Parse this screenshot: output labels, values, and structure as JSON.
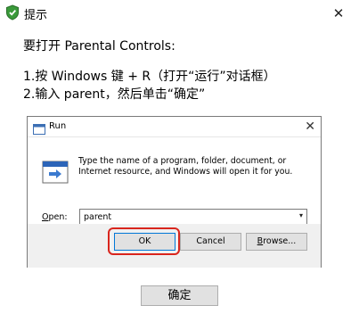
{
  "window": {
    "title": "提示",
    "close_glyph": "✕"
  },
  "instructions": {
    "heading": "要打开 Parental Controls:",
    "step1": "1.按 Windows 键 + R（打开“运行”对话框）",
    "step2": "2.输入 parent，然后单击“确定”"
  },
  "run_dialog": {
    "title": "Run",
    "close_glyph": "✕",
    "description": "Type the name of a program, folder, document, or Internet resource, and Windows will open it for you.",
    "open_label_accel": "O",
    "open_label_rest": "pen:",
    "open_value": "parent",
    "dropdown_glyph": "▾",
    "ok_label": "OK",
    "cancel_label": "Cancel",
    "browse_label_accel": "B",
    "browse_label_rest": "rowse...",
    "highlight_color": "#d9251d"
  },
  "footer": {
    "confirm_label": "确定"
  }
}
